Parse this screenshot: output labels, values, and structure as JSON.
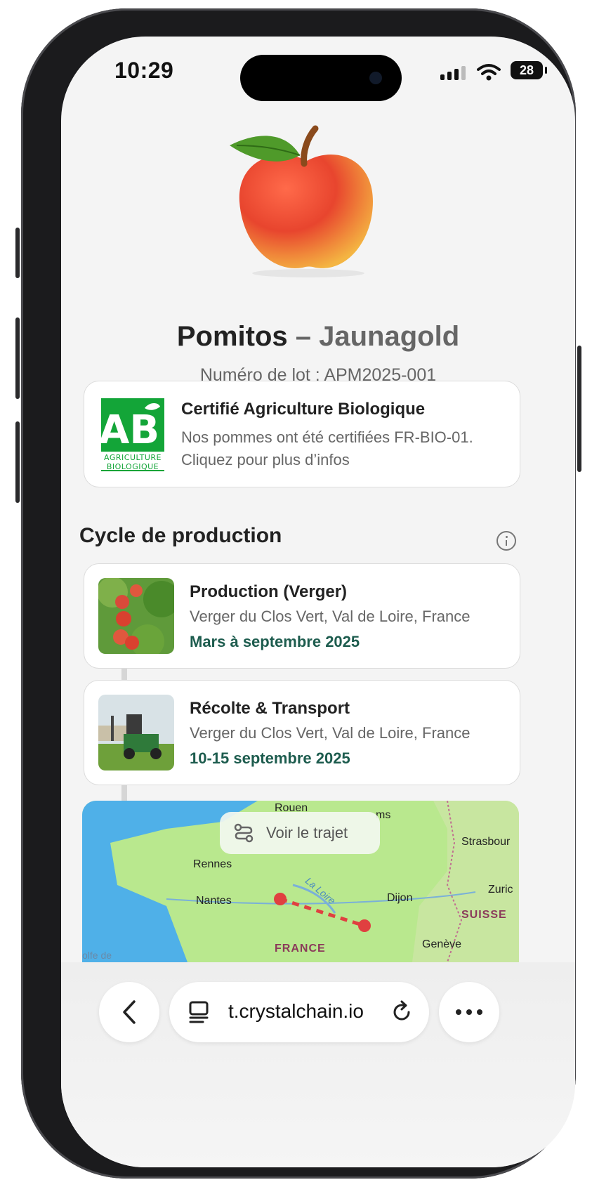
{
  "status": {
    "time": "10:29",
    "battery": "28"
  },
  "product": {
    "brand": "Pomitos",
    "separator": " – ",
    "variety": "Jaunagold",
    "lot": "Numéro de lot : APM2025-001"
  },
  "certification": {
    "title": "Certifié Agriculture Biologique",
    "desc": "Nos pommes ont été certifiées FR-BIO-01. Cliquez pour plus d’infos",
    "logo_text": "AB",
    "logo_sub1": "AGRICULTURE",
    "logo_sub2": "BIOLOGIQUE",
    "brand_color": "#13a538"
  },
  "cycle": {
    "title": "Cycle de production",
    "steps": [
      {
        "title": "Production (Verger)",
        "place": "Verger du Clos Vert, Val de Loire, France",
        "date": "Mars à septembre 2025"
      },
      {
        "title": "Récolte & Transport",
        "place": "Verger du Clos Vert, Val de Loire, France",
        "date": "10-15 septembre 2025"
      }
    ]
  },
  "map": {
    "button": "Voir le trajet",
    "cities": [
      "Rouen",
      "Rennes",
      "Nantes",
      "Dijon",
      "Strasbour",
      "Zuric",
      "Genève",
      "ms"
    ],
    "labels": [
      "La Loire",
      "FRANCE",
      "SUISSE",
      "olfe de"
    ]
  },
  "browser": {
    "url": "t.crystalchain.io"
  }
}
